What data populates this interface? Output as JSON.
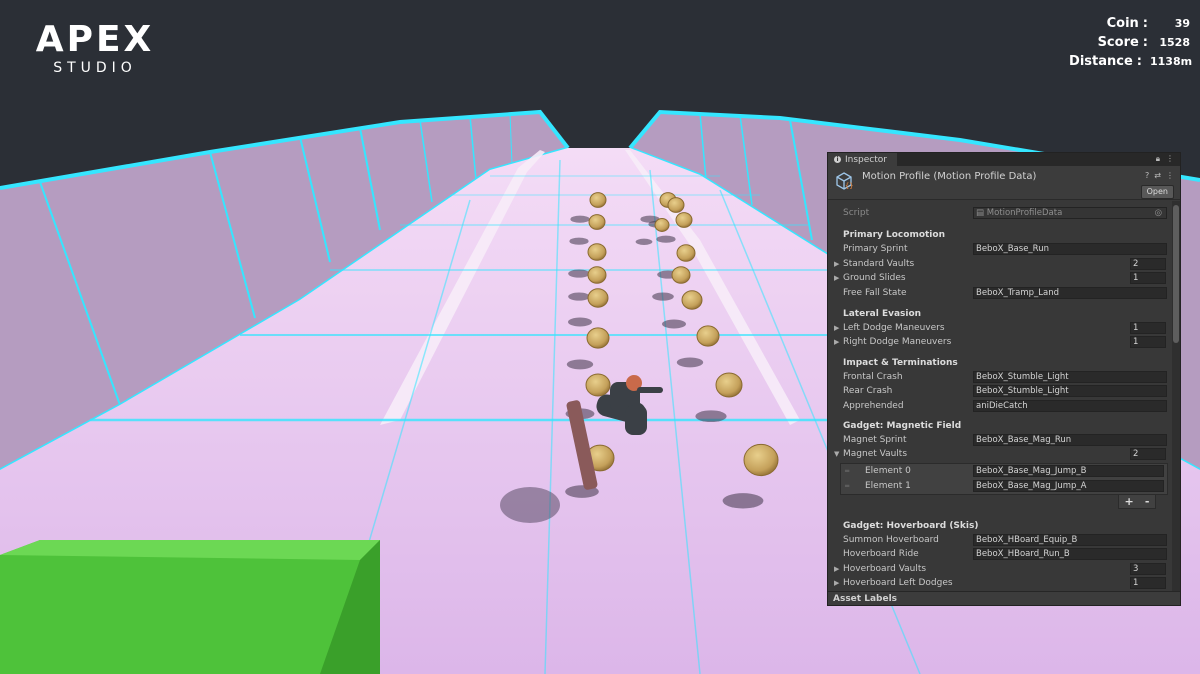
{
  "brand": {
    "main": "APEX",
    "sub": "STUDIO"
  },
  "hud": {
    "coin": {
      "label": "Coin",
      "value": "39"
    },
    "score": {
      "label": "Score",
      "value": "1528"
    },
    "distance": {
      "label": "Distance",
      "value": "1138m"
    }
  },
  "inspector": {
    "tab_label": "Inspector",
    "asset_title": "Motion Profile (Motion Profile Data)",
    "open_label": "Open",
    "script": {
      "label": "Script",
      "value": "MotionProfileData"
    },
    "sections": {
      "primary": "Primary Locomotion",
      "lateral": "Lateral Evasion",
      "impact": "Impact & Terminations",
      "magnet": "Gadget: Magnetic Field",
      "hoverboard": "Gadget: Hoverboard (Skis)"
    },
    "fields": {
      "primary_sprint": {
        "label": "Primary Sprint",
        "value": "BeboX_Base_Run"
      },
      "standard_vaults": {
        "label": "Standard Vaults",
        "value": "2"
      },
      "ground_slides": {
        "label": "Ground Slides",
        "value": "1"
      },
      "free_fall_state": {
        "label": "Free Fall State",
        "value": "BeboX_Tramp_Land"
      },
      "left_dodge": {
        "label": "Left Dodge Maneuvers",
        "value": "1"
      },
      "right_dodge": {
        "label": "Right Dodge Maneuvers",
        "value": "1"
      },
      "frontal_crash": {
        "label": "Frontal Crash",
        "value": "BeboX_Stumble_Light"
      },
      "rear_crash": {
        "label": "Rear Crash",
        "value": "BeboX_Stumble_Light"
      },
      "apprehended": {
        "label": "Apprehended",
        "value": "aniDieCatch"
      },
      "magnet_sprint": {
        "label": "Magnet Sprint",
        "value": "BeboX_Base_Mag_Run"
      },
      "magnet_vaults": {
        "label": "Magnet Vaults",
        "value": "2"
      },
      "summon_hoverboard": {
        "label": "Summon Hoverboard",
        "value": "BeboX_HBoard_Equip_B"
      },
      "hoverboard_ride": {
        "label": "Hoverboard Ride",
        "value": "BeboX_HBoard_Run_B"
      },
      "hoverboard_vaults": {
        "label": "Hoverboard Vaults",
        "value": "3"
      },
      "hoverboard_left_dodges": {
        "label": "Hoverboard Left Dodges",
        "value": "1"
      }
    },
    "magnet_elements": [
      {
        "label": "Element 0",
        "value": "BeboX_Base_Mag_Jump_B"
      },
      {
        "label": "Element 1",
        "value": "BeboX_Base_Mag_Jump_A"
      }
    ],
    "plus": "+",
    "minus": "-",
    "footer": "Asset Labels"
  },
  "colors": {
    "sky": "#2b2f36",
    "track": "#e6c4ee",
    "wall": "#b9a0c2",
    "neon": "#35e6ff",
    "coin": "#c9a55a",
    "block": "#4ec23a"
  }
}
